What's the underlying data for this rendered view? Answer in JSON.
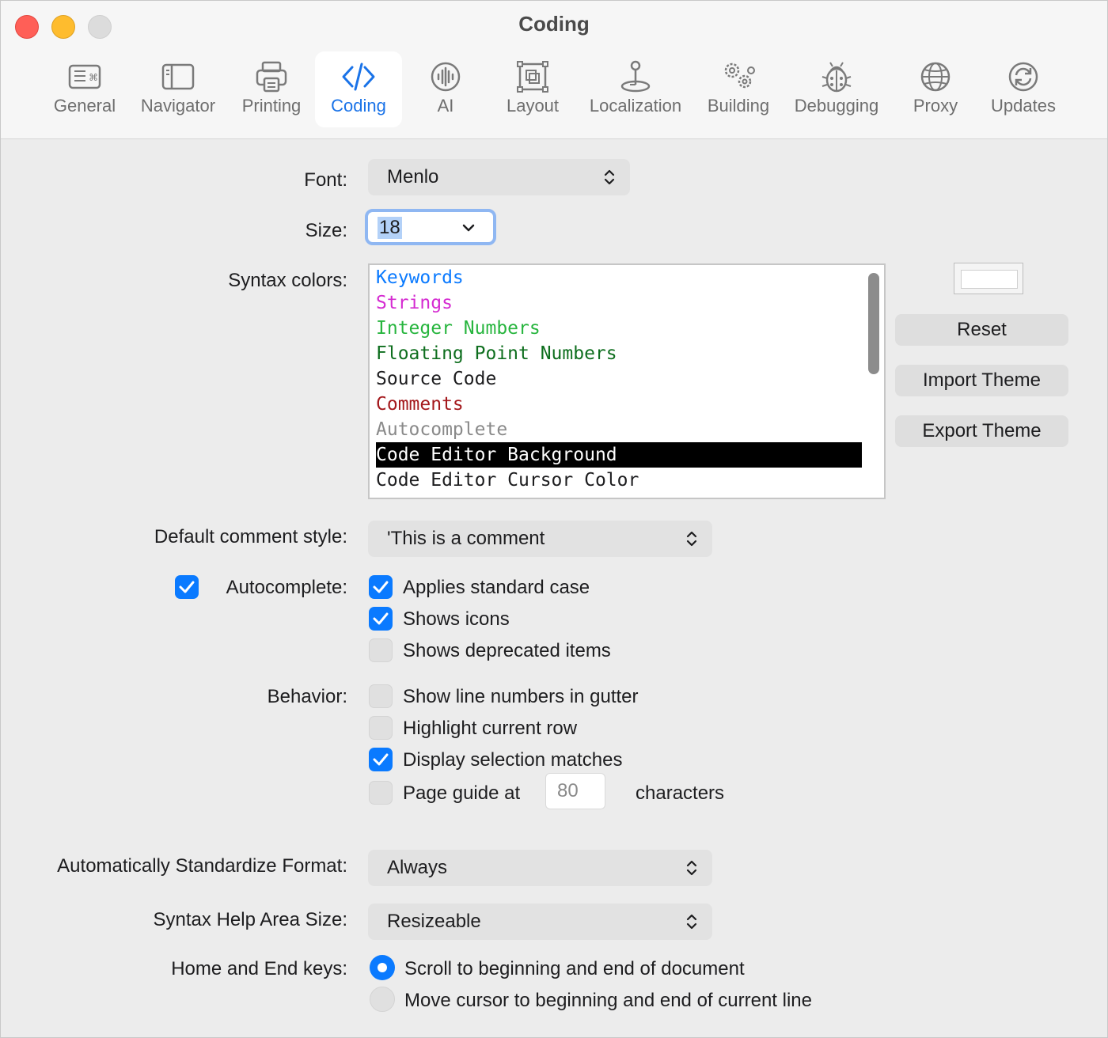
{
  "window": {
    "title": "Coding"
  },
  "toolbar": {
    "items": [
      {
        "label": "General",
        "icon": "keyboard-icon"
      },
      {
        "label": "Navigator",
        "icon": "sidebar-icon"
      },
      {
        "label": "Printing",
        "icon": "printer-icon"
      },
      {
        "label": "Coding",
        "icon": "code-brackets-icon",
        "selected": true
      },
      {
        "label": "AI",
        "icon": "waveform-icon"
      },
      {
        "label": "Layout",
        "icon": "layout-frame-icon"
      },
      {
        "label": "Localization",
        "icon": "joystick-icon"
      },
      {
        "label": "Building",
        "icon": "gears-icon"
      },
      {
        "label": "Debugging",
        "icon": "ladybug-icon"
      },
      {
        "label": "Proxy",
        "icon": "globe-icon"
      },
      {
        "label": "Updates",
        "icon": "refresh-icon"
      }
    ]
  },
  "font": {
    "label": "Font:",
    "value": "Menlo"
  },
  "size": {
    "label": "Size:",
    "value": "18"
  },
  "syntax_colors": {
    "label": "Syntax colors:",
    "items": [
      {
        "label": "Keywords",
        "color": "#0a7aff"
      },
      {
        "label": "Strings",
        "color": "#d52bd1"
      },
      {
        "label": "Integer Numbers",
        "color": "#27b53e"
      },
      {
        "label": "Floating Point Numbers",
        "color": "#0e6e1e"
      },
      {
        "label": "Source Code",
        "color": "#1d1d1f"
      },
      {
        "label": "Comments",
        "color": "#a4191d"
      },
      {
        "label": "Autocomplete",
        "color": "#8a8a8a"
      },
      {
        "label": "Code Editor Background",
        "color": "#ffffff",
        "selected": true
      },
      {
        "label": "Code Editor Cursor Color",
        "color": "#1d1d1f"
      }
    ],
    "swatch_color": "#ffffff"
  },
  "buttons": {
    "reset": "Reset",
    "import_theme": "Import Theme",
    "export_theme": "Export Theme"
  },
  "comment_style": {
    "label": "Default comment style:",
    "value": "'This is a comment"
  },
  "autocomplete": {
    "label": "Autocomplete:",
    "checked": true,
    "options": [
      {
        "label": "Applies standard case",
        "checked": true
      },
      {
        "label": "Shows icons",
        "checked": true
      },
      {
        "label": "Shows deprecated items",
        "checked": false
      }
    ]
  },
  "behavior": {
    "label": "Behavior:",
    "options": [
      {
        "label": "Show line numbers in gutter",
        "checked": false
      },
      {
        "label": "Highlight current row",
        "checked": false
      },
      {
        "label": "Display selection matches",
        "checked": true
      }
    ],
    "page_guide": {
      "label_before": "Page guide at",
      "value": "80",
      "label_after": "characters",
      "checked": false
    }
  },
  "standardize_format": {
    "label": "Automatically Standardize Format:",
    "value": "Always"
  },
  "syntax_help": {
    "label": "Syntax Help Area Size:",
    "value": "Resizeable"
  },
  "home_end": {
    "label": "Home and End keys:",
    "options": [
      {
        "label": "Scroll to beginning and end of document",
        "selected": true
      },
      {
        "label": "Move cursor to beginning and end of current line",
        "selected": false
      }
    ]
  },
  "colors": {
    "accent": "#0a7aff",
    "focus_ring": "#8fb7f2",
    "selection_bg": "#000000"
  }
}
